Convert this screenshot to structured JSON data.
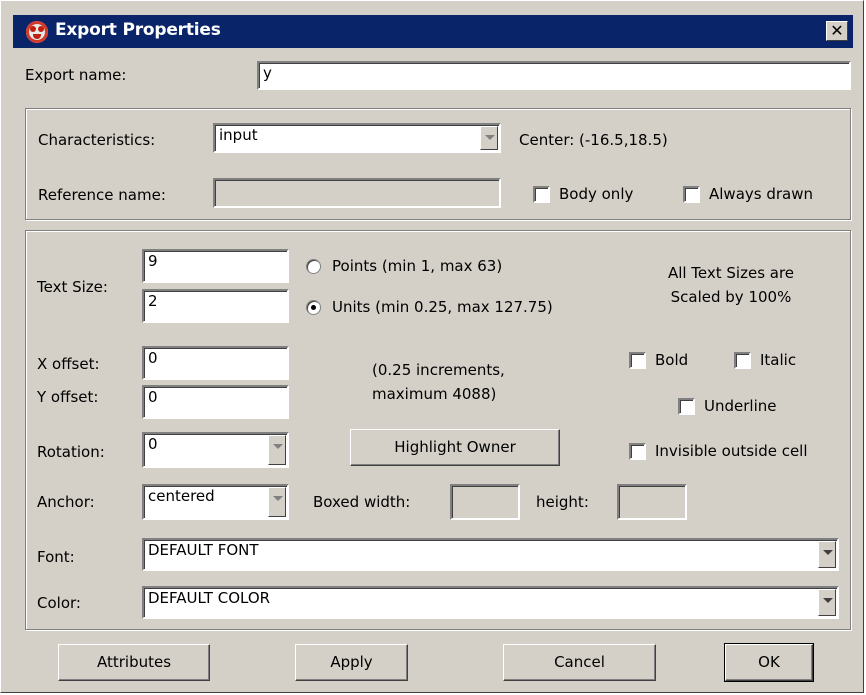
{
  "window": {
    "title": "Export Properties",
    "close_glyph": "✕"
  },
  "export_name": {
    "label": "Export name:",
    "value": "y"
  },
  "characteristics": {
    "label": "Characteristics:",
    "value": "input",
    "center_text": "Center: (-16.5,18.5)"
  },
  "reference": {
    "label": "Reference name:",
    "value": ""
  },
  "checkboxes": {
    "body_only": "Body only",
    "always_drawn": "Always drawn",
    "bold": "Bold",
    "italic": "Italic",
    "underline": "Underline",
    "invisible_outside": "Invisible outside cell"
  },
  "text_size": {
    "label": "Text Size:",
    "points_value": "9",
    "units_value": "2",
    "points_label": "Points (min 1, max 63)",
    "units_label": "Units (min 0.25, max 127.75)",
    "selected": "units",
    "scale_line1": "All Text Sizes are",
    "scale_line2": "Scaled by 100%"
  },
  "offset": {
    "x_label": "X offset:",
    "x_value": "0",
    "y_label": "Y offset:",
    "y_value": "0",
    "note_line1": "(0.25 increments,",
    "note_line2": "maximum 4088)"
  },
  "rotation": {
    "label": "Rotation:",
    "value": "0"
  },
  "highlight_button": "Highlight Owner",
  "anchor": {
    "label": "Anchor:",
    "value": "centered",
    "boxed_width_label": "Boxed width:",
    "boxed_width_value": "",
    "height_label": "height:",
    "height_value": ""
  },
  "font": {
    "label": "Font:",
    "value": "DEFAULT FONT"
  },
  "color": {
    "label": "Color:",
    "value": "DEFAULT COLOR"
  },
  "buttons": {
    "attributes": "Attributes",
    "apply": "Apply",
    "cancel": "Cancel",
    "ok": "OK"
  },
  "icons": {
    "app": "app-face-icon",
    "close": "close-icon",
    "dropdown": "chevron-down-icon"
  },
  "colors": {
    "titlebar": "#0a246a",
    "dialog": "#d4d0c8"
  }
}
